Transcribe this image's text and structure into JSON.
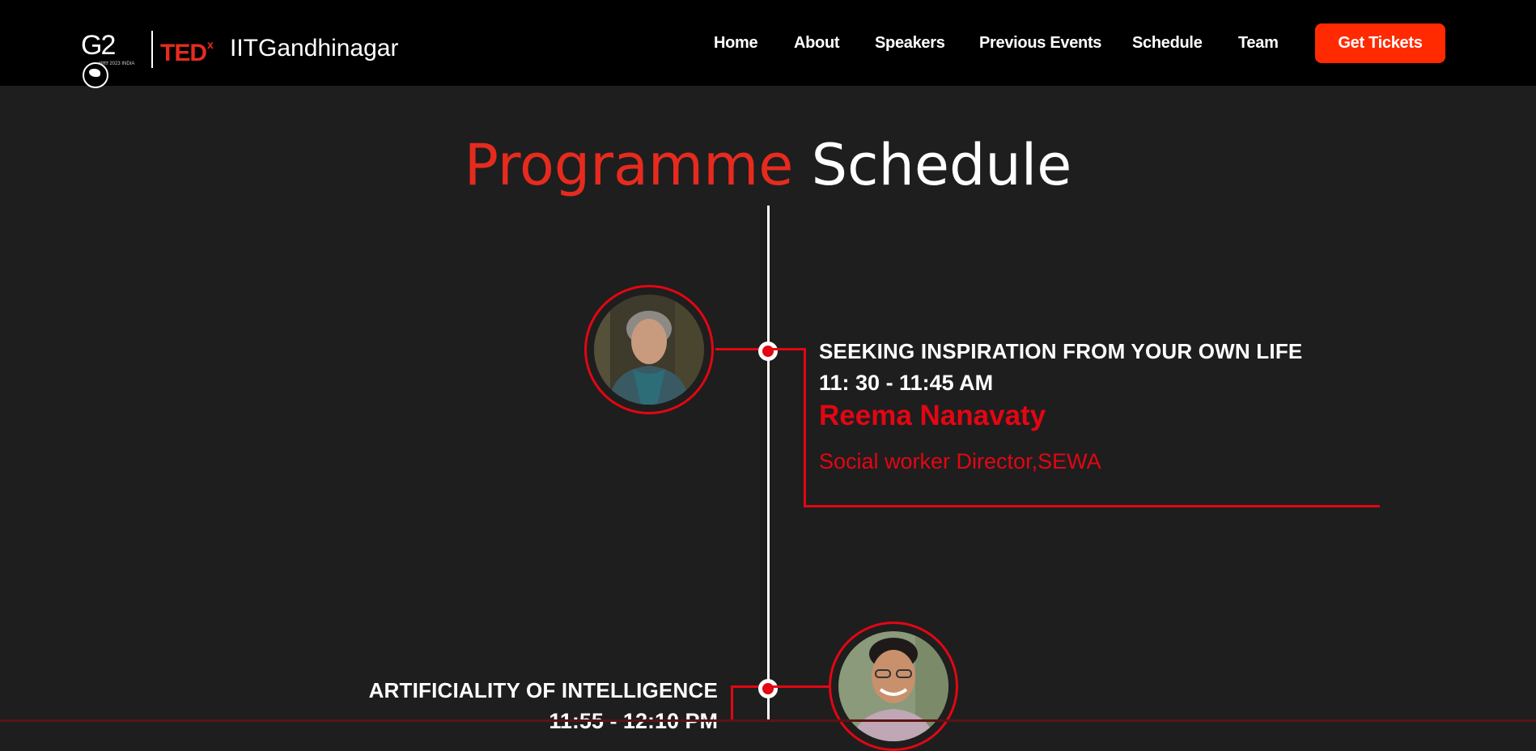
{
  "header": {
    "g20_text": "G2",
    "g20_tagline": "भारत 2023 INDIA",
    "brand_ted": "TED",
    "brand_x": "x",
    "brand_event": "IITGandhinagar",
    "nav": [
      "Home",
      "About",
      "Speakers",
      "Previous Events",
      "Schedule",
      "Team"
    ],
    "cta_label": "Get Tickets"
  },
  "section": {
    "title_accent": "Programme",
    "title_rest": "Schedule"
  },
  "talks": [
    {
      "title": "SEEKING INSPIRATION FROM YOUR OWN LIFE",
      "time": "11: 30 - 11:45 AM",
      "speaker": "Reema Nanavaty",
      "role": "Social worker Director,SEWA"
    },
    {
      "title": "ARTIFICIALITY OF INTELLIGENCE",
      "time": "11:55 - 12:10 PM"
    }
  ],
  "colors": {
    "accent": "#e30613",
    "cta": "#ff2a00",
    "background": "#1e1e1e",
    "header": "#000000"
  }
}
